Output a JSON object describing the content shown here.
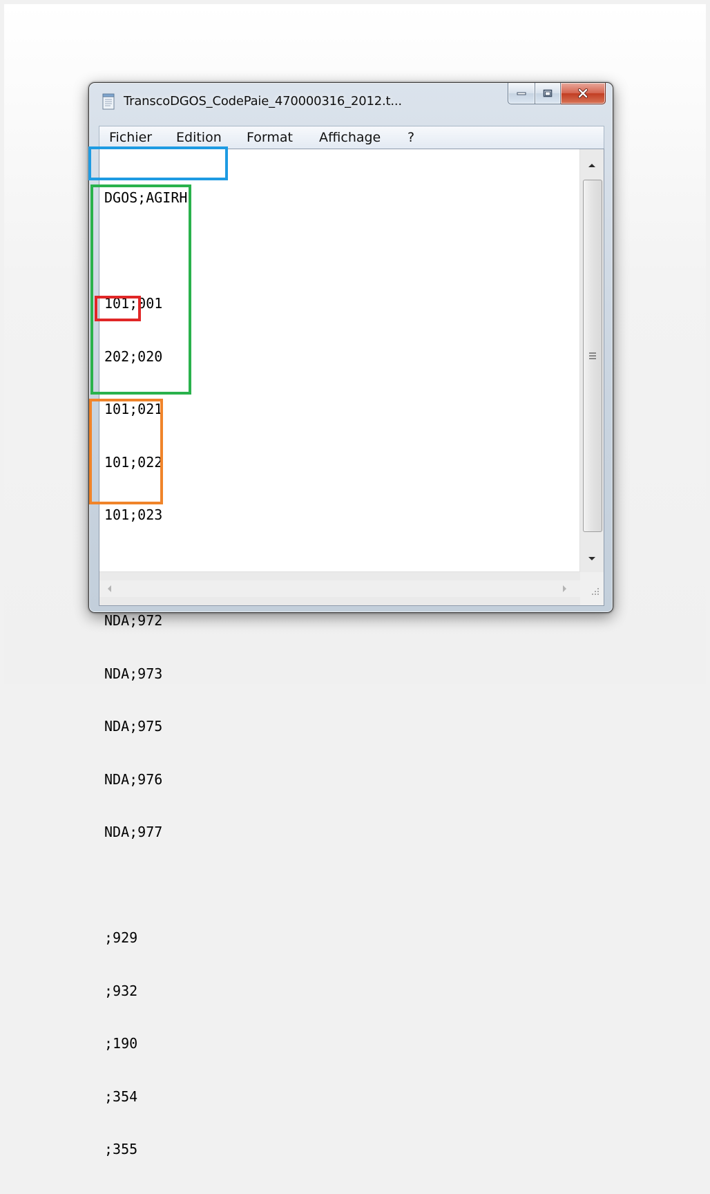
{
  "window": {
    "title": "TranscoDGOS_CodePaie_470000316_2012.t...",
    "icon": "notepad-icon"
  },
  "caption_buttons": {
    "minimize_icon": "minimize-icon",
    "maximize_icon": "maximize-icon",
    "close_icon": "close-icon"
  },
  "menu": {
    "items": [
      "Fichier",
      "Edition",
      "Format",
      "Affichage",
      "?"
    ]
  },
  "document": {
    "lines": [
      "DGOS;AGIRH",
      "",
      "101;001",
      "202;020",
      "101;021",
      "101;022",
      "101;023",
      "",
      "NDA;972",
      "NDA;973",
      "NDA;975",
      "NDA;976",
      "NDA;977",
      "",
      ";929",
      ";932",
      ";190",
      ";354",
      ";355"
    ]
  },
  "annotations": {
    "colors": {
      "header": "#1e9be2",
      "valid_codes": "#2ab24c",
      "error_marker": "#e02727",
      "missing_codes": "#f0842a"
    }
  }
}
